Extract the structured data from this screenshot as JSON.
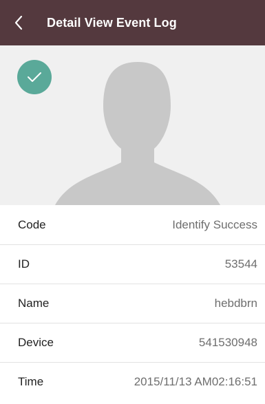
{
  "header": {
    "title": "Detail View Event Log",
    "background": "#54393e",
    "back_icon": "chevron-left-icon"
  },
  "photo": {
    "placeholder_icon": "person-silhouette-icon",
    "status_icon": "check-icon",
    "status_color": "#5aa999"
  },
  "details": [
    {
      "label": "Code",
      "value": "Identify Success"
    },
    {
      "label": "ID",
      "value": "53544"
    },
    {
      "label": "Name",
      "value": "hebdbrn"
    },
    {
      "label": "Device",
      "value": "541530948"
    },
    {
      "label": "Time",
      "value": "2015/11/13 AM02:16:51"
    }
  ]
}
